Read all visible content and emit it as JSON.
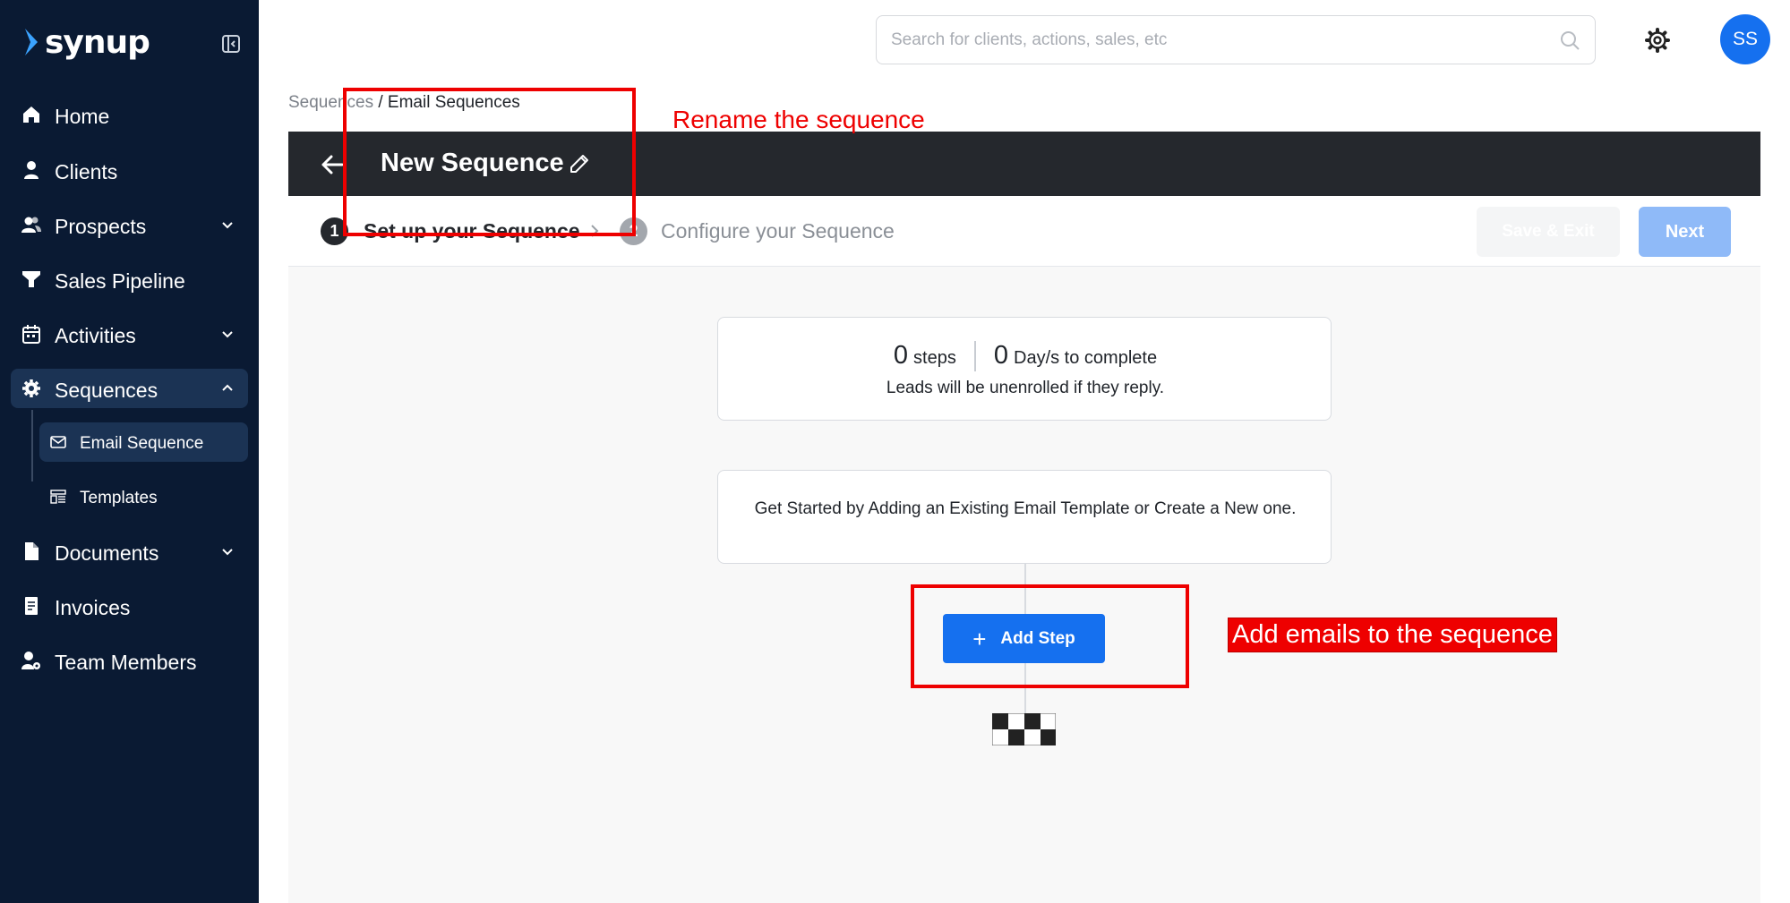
{
  "brand": {
    "name": "synup"
  },
  "sidebar": {
    "items": [
      {
        "label": "Home"
      },
      {
        "label": "Clients"
      },
      {
        "label": "Prospects"
      },
      {
        "label": "Sales Pipeline"
      },
      {
        "label": "Activities"
      },
      {
        "label": "Sequences"
      },
      {
        "label": "Documents"
      },
      {
        "label": "Invoices"
      },
      {
        "label": "Team Members"
      }
    ],
    "sequences_sub": [
      {
        "label": "Email Sequence"
      },
      {
        "label": "Templates"
      }
    ]
  },
  "header": {
    "search_placeholder": "Search for clients, actions, sales, etc",
    "avatar_initials": "SS"
  },
  "breadcrumb": {
    "parent": "Sequences",
    "separator": " / ",
    "current": "Email Sequences"
  },
  "sequence": {
    "title": "New Sequence"
  },
  "steps": {
    "step1_number": "1",
    "step1_label": "Set up your Sequence",
    "step2_number": "2",
    "step2_label": "Configure your Sequence",
    "save_exit_label": "Save & Exit",
    "next_label": "Next"
  },
  "summary": {
    "steps_count": "0",
    "steps_label": "steps",
    "days_count": "0",
    "days_label": "Day/s to complete",
    "note": "Leads will be unenrolled if they reply."
  },
  "start_card": {
    "text": "Get Started by Adding an Existing Email Template or Create a New one."
  },
  "add_step": {
    "plus": "+",
    "label": "Add Step"
  },
  "annotations": {
    "rename": "Rename the sequence",
    "add_emails": "Add emails to the sequence"
  },
  "colors": {
    "sidebar_bg": "#0a1a33",
    "sidebar_active": "#1b3354",
    "primary": "#1570ef",
    "header_dark": "#25282d",
    "annotation_red": "#ee0000"
  }
}
